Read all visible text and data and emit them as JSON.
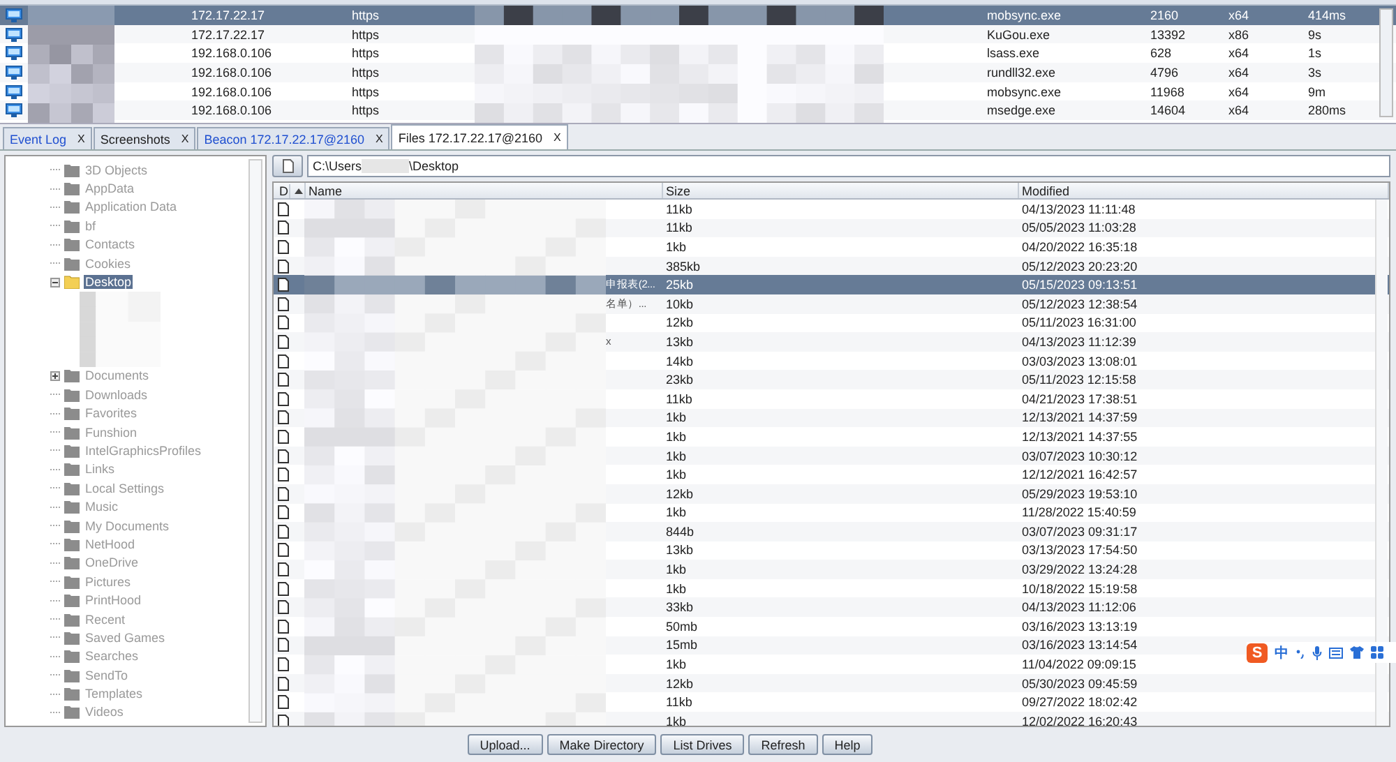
{
  "sessions": [
    {
      "internal": "172.17.22.17",
      "listener": "https",
      "process": "mobsync.exe",
      "pid": "2160",
      "arch": "x64",
      "last": "414ms",
      "selected": true
    },
    {
      "internal": "172.17.22.17",
      "listener": "https",
      "process": "KuGou.exe",
      "pid": "13392",
      "arch": "x86",
      "last": "9s",
      "selected": false
    },
    {
      "internal": "192.168.0.106",
      "listener": "https",
      "process": "lsass.exe",
      "pid": "628",
      "arch": "x64",
      "last": "1s",
      "selected": false
    },
    {
      "internal": "192.168.0.106",
      "listener": "https",
      "process": "rundll32.exe",
      "pid": "4796",
      "arch": "x64",
      "last": "3s",
      "selected": false
    },
    {
      "internal": "192.168.0.106",
      "listener": "https",
      "process": "mobsync.exe",
      "pid": "11968",
      "arch": "x64",
      "last": "9m",
      "selected": false
    },
    {
      "internal": "192.168.0.106",
      "listener": "https",
      "process": "msedge.exe",
      "pid": "14604",
      "arch": "x64",
      "last": "280ms",
      "selected": false
    }
  ],
  "tabs": [
    {
      "label": "Event Log",
      "close": "X",
      "highlighted": true,
      "selected": false
    },
    {
      "label": "Screenshots",
      "close": "X",
      "highlighted": false,
      "selected": false
    },
    {
      "label": "Beacon 172.17.22.17@2160",
      "close": "X",
      "highlighted": true,
      "selected": false
    },
    {
      "label": "Files 172.17.22.17@2160",
      "close": "X",
      "highlighted": false,
      "selected": true
    }
  ],
  "tree": [
    {
      "label": "3D Objects",
      "selected": false
    },
    {
      "label": "AppData",
      "selected": false
    },
    {
      "label": "Application Data",
      "selected": false
    },
    {
      "label": "bf",
      "selected": false
    },
    {
      "label": "Contacts",
      "selected": false
    },
    {
      "label": "Cookies",
      "selected": false
    },
    {
      "label": "Desktop",
      "expanded": true,
      "selected": true
    },
    {
      "label": "Documents",
      "expanded": false,
      "selected": false
    },
    {
      "label": "Downloads",
      "selected": false
    },
    {
      "label": "Favorites",
      "selected": false
    },
    {
      "label": "Funshion",
      "selected": false
    },
    {
      "label": "IntelGraphicsProfiles",
      "selected": false
    },
    {
      "label": "Links",
      "selected": false
    },
    {
      "label": "Local Settings",
      "selected": false
    },
    {
      "label": "Music",
      "selected": false
    },
    {
      "label": "My Documents",
      "selected": false
    },
    {
      "label": "NetHood",
      "selected": false
    },
    {
      "label": "OneDrive",
      "selected": false
    },
    {
      "label": "Pictures",
      "selected": false
    },
    {
      "label": "PrintHood",
      "selected": false
    },
    {
      "label": "Recent",
      "selected": false
    },
    {
      "label": "Saved Games",
      "selected": false
    },
    {
      "label": "Searches",
      "selected": false
    },
    {
      "label": "SendTo",
      "selected": false
    },
    {
      "label": "Templates",
      "selected": false
    },
    {
      "label": "Videos",
      "selected": false
    }
  ],
  "path": {
    "start": "C:\\Users",
    "end": "\\Desktop"
  },
  "columns": [
    "D",
    "Name",
    "Size",
    "Modified"
  ],
  "files": [
    {
      "size": "11kb",
      "modified": "04/13/2023 11:11:48",
      "selected": false
    },
    {
      "size": "11kb",
      "modified": "05/05/2023 11:03:28",
      "selected": false
    },
    {
      "size": "1kb",
      "modified": "04/20/2022 16:35:18",
      "selected": false
    },
    {
      "size": "385kb",
      "modified": "05/12/2023 20:23:20",
      "selected": false
    },
    {
      "name_tail": "申报表(2...",
      "size": "25kb",
      "modified": "05/15/2023 09:13:51",
      "selected": true
    },
    {
      "name_tail": "名单）...",
      "size": "10kb",
      "modified": "05/12/2023 12:38:54",
      "selected": false
    },
    {
      "size": "12kb",
      "modified": "05/11/2023 16:31:00",
      "selected": false
    },
    {
      "name_tail": "x",
      "size": "13kb",
      "modified": "04/13/2023 11:12:39",
      "selected": false
    },
    {
      "size": "14kb",
      "modified": "03/03/2023 13:08:01",
      "selected": false
    },
    {
      "size": "23kb",
      "modified": "05/11/2023 12:15:58",
      "selected": false
    },
    {
      "size": "11kb",
      "modified": "04/21/2023 17:38:51",
      "selected": false
    },
    {
      "size": "1kb",
      "modified": "12/13/2021 14:37:59",
      "selected": false
    },
    {
      "size": "1kb",
      "modified": "12/13/2021 14:37:55",
      "selected": false
    },
    {
      "size": "1kb",
      "modified": "03/07/2023 10:30:12",
      "selected": false
    },
    {
      "size": "1kb",
      "modified": "12/12/2021 16:42:57",
      "selected": false
    },
    {
      "size": "12kb",
      "modified": "05/29/2023 19:53:10",
      "selected": false
    },
    {
      "size": "1kb",
      "modified": "11/28/2022 15:40:59",
      "selected": false
    },
    {
      "size": "844b",
      "modified": "03/07/2023 09:31:17",
      "selected": false
    },
    {
      "size": "13kb",
      "modified": "03/13/2023 17:54:50",
      "selected": false
    },
    {
      "size": "1kb",
      "modified": "03/29/2022 13:24:28",
      "selected": false
    },
    {
      "size": "1kb",
      "modified": "10/18/2022 15:19:58",
      "selected": false
    },
    {
      "size": "33kb",
      "modified": "04/13/2023 11:12:06",
      "selected": false
    },
    {
      "size": "50mb",
      "modified": "03/16/2023 13:13:19",
      "selected": false
    },
    {
      "size": "15mb",
      "modified": "03/16/2023 13:14:54",
      "selected": false
    },
    {
      "size": "1kb",
      "modified": "11/04/2022 09:09:15",
      "selected": false
    },
    {
      "size": "12kb",
      "modified": "05/30/2023 09:45:59",
      "selected": false
    },
    {
      "size": "11kb",
      "modified": "09/27/2022 18:02:42",
      "selected": false
    },
    {
      "size": "1kb",
      "modified": "12/02/2022 16:20:43",
      "selected": false
    }
  ],
  "buttons": [
    "Upload...",
    "Make Directory",
    "List Drives",
    "Refresh",
    "Help"
  ],
  "ime": {
    "logo": "S",
    "mode": "中"
  }
}
